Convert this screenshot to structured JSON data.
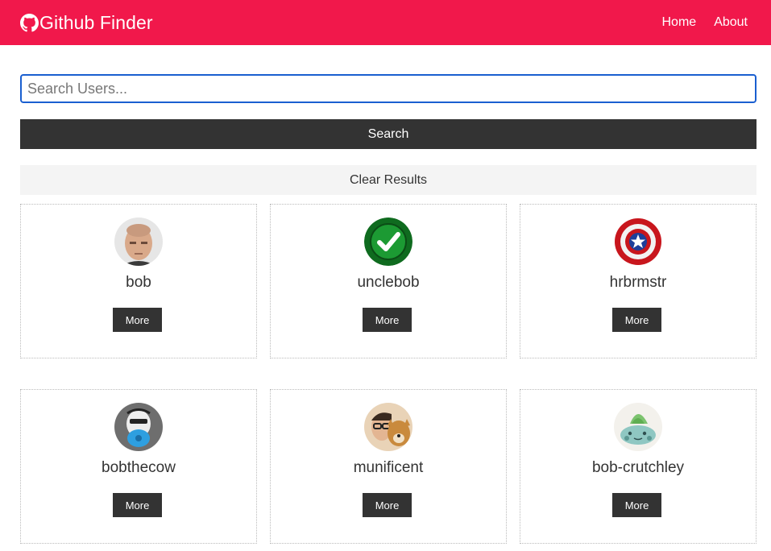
{
  "navbar": {
    "brand_icon": "github-icon",
    "title": "Github Finder",
    "background": "#f1184b",
    "links": [
      {
        "label": "Home"
      },
      {
        "label": "About"
      }
    ]
  },
  "search": {
    "placeholder": "Search Users...",
    "value": "",
    "button_label": "Search",
    "clear_label": "Clear Results"
  },
  "users": [
    {
      "login": "bob",
      "more_label": "More",
      "avatar": "avatar-bob"
    },
    {
      "login": "unclebob",
      "more_label": "More",
      "avatar": "avatar-unclebob"
    },
    {
      "login": "hrbrmstr",
      "more_label": "More",
      "avatar": "avatar-hrbrmstr"
    },
    {
      "login": "bobthecow",
      "more_label": "More",
      "avatar": "avatar-bobthecow"
    },
    {
      "login": "munificent",
      "more_label": "More",
      "avatar": "avatar-munificent"
    },
    {
      "login": "bob-crutchley",
      "more_label": "More",
      "avatar": "avatar-bob-crutchley"
    }
  ]
}
